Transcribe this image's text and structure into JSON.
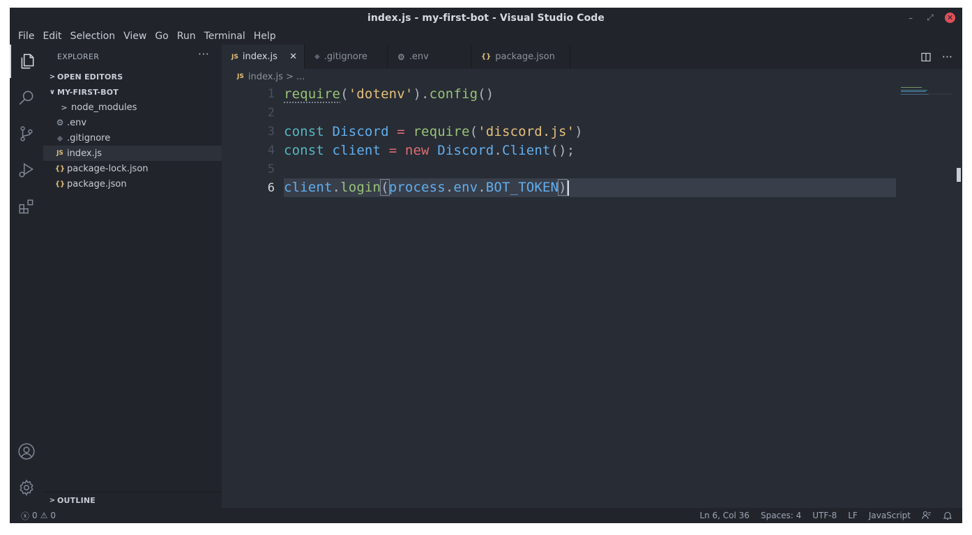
{
  "window": {
    "title": "index.js - my-first-bot - Visual Studio Code"
  },
  "menu": [
    "File",
    "Edit",
    "Selection",
    "View",
    "Go",
    "Run",
    "Terminal",
    "Help"
  ],
  "activity": [
    "files-icon",
    "search-icon",
    "source-control-icon",
    "run-debug-icon",
    "extensions-icon",
    "account-icon",
    "settings-gear-icon"
  ],
  "sidebar": {
    "header": "EXPLORER",
    "open_editors": "OPEN EDITORS",
    "project": "MY-FIRST-BOT",
    "files": [
      {
        "name": "node_modules",
        "icon": ">",
        "type": "folder"
      },
      {
        "name": ".env",
        "icon": "⚙",
        "type": "file"
      },
      {
        "name": ".gitignore",
        "icon": "◆",
        "type": "file"
      },
      {
        "name": "index.js",
        "icon": "JS",
        "type": "file"
      },
      {
        "name": "package-lock.json",
        "icon": "{}",
        "type": "file"
      },
      {
        "name": "package.json",
        "icon": "{}",
        "type": "file"
      }
    ],
    "outline": "OUTLINE"
  },
  "tabs": [
    {
      "label": "index.js",
      "icon": "JS"
    },
    {
      "label": ".gitignore",
      "icon": "◆"
    },
    {
      "label": ".env",
      "icon": "⚙"
    },
    {
      "label": "package.json",
      "icon": "{}"
    }
  ],
  "breadcrumb": {
    "file": "index.js",
    "sep": ">",
    "rest": "..."
  },
  "editor": {
    "line_numbers": [
      "1",
      "2",
      "3",
      "4",
      "5",
      "6"
    ],
    "code": {
      "l1_require": "require",
      "l1_p1": "(",
      "l1_str": "'dotenv'",
      "l1_p2": ").",
      "l1_config": "config",
      "l1_p3": "()",
      "l3_const": "const",
      "l3_var": "Discord",
      "l3_eq": "=",
      "l3_require": "require",
      "l3_p1": "(",
      "l3_str": "'discord.js'",
      "l3_p2": ")",
      "l4_const": "const",
      "l4_var": "client",
      "l4_eq": "=",
      "l4_new": "new",
      "l4_cls": "Discord",
      "l4_dot": ".",
      "l4_ctor": "Client",
      "l4_end": "();",
      "l6_client": "client",
      "l6_dot1": ".",
      "l6_login": "login",
      "l6_p1": "(",
      "l6_process": "process",
      "l6_dot2": ".",
      "l6_env": "env",
      "l6_dot3": ".",
      "l6_token": "BOT_TOKEN",
      "l6_p2": ")"
    }
  },
  "status": {
    "errors": "0",
    "warnings": "0",
    "position": "Ln 6, Col 36",
    "spaces": "Spaces: 4",
    "encoding": "UTF-8",
    "eol": "LF",
    "language": "JavaScript"
  },
  "colors": {
    "background": "#282c34",
    "sidebar": "#21252b",
    "string": "#e5c07b",
    "function": "#98c379",
    "keyword": "#56b6c2",
    "class": "#61afef",
    "new_keyword": "#e06c75",
    "close_button": "#e0505a"
  }
}
